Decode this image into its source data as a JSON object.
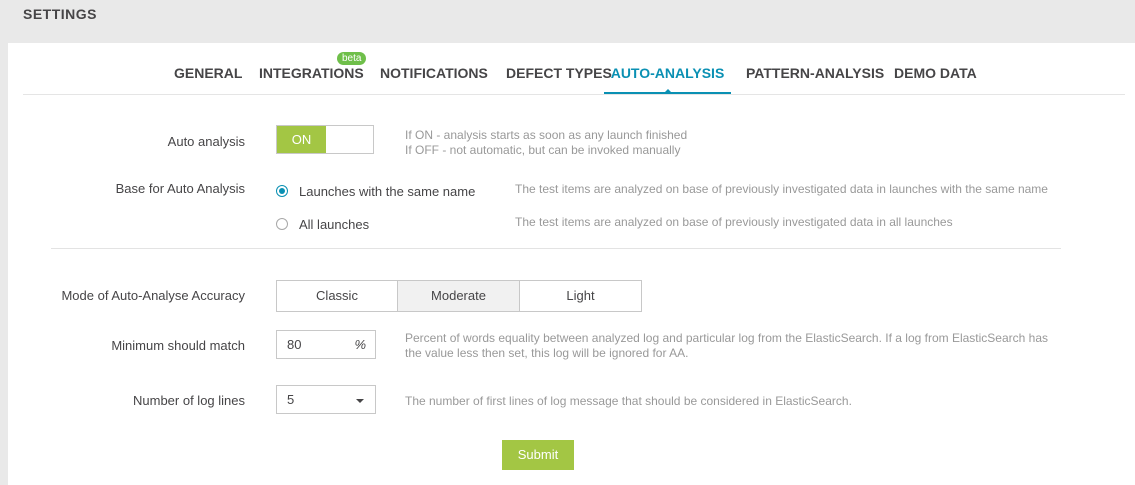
{
  "header": {
    "title": "SETTINGS"
  },
  "tabs": [
    {
      "label": "GENERAL"
    },
    {
      "label": "INTEGRATIONS",
      "badge": "beta"
    },
    {
      "label": "NOTIFICATIONS"
    },
    {
      "label": "DEFECT TYPES"
    },
    {
      "label": "AUTO-ANALYSIS",
      "active": true
    },
    {
      "label": "PATTERN-ANALYSIS"
    },
    {
      "label": "DEMO DATA"
    }
  ],
  "auto_analysis": {
    "label": "Auto analysis",
    "toggle_value": "ON",
    "hint_line1": "If ON - analysis starts as soon as any launch finished",
    "hint_line2": "If OFF - not automatic, but can be invoked manually"
  },
  "base": {
    "label": "Base for Auto Analysis",
    "options": [
      {
        "label": "Launches with the same name",
        "checked": true,
        "hint": "The test items are analyzed on base of previously investigated data in launches with the same name"
      },
      {
        "label": "All launches",
        "checked": false,
        "hint": "The test items are analyzed on base of previously investigated data in all launches"
      }
    ]
  },
  "mode": {
    "label": "Mode of Auto-Analyse Accuracy",
    "options": [
      "Classic",
      "Moderate",
      "Light"
    ],
    "selected": "Moderate"
  },
  "min_match": {
    "label": "Minimum should match",
    "value": "80",
    "suffix": "%",
    "hint_line1": "Percent of words equality between analyzed log and particular log from the ElasticSearch. If a log from ElasticSearch has",
    "hint_line2": "the value less then set, this log will be ignored for AA."
  },
  "log_lines": {
    "label": "Number of log lines",
    "value": "5",
    "hint": "The number of first lines of log message that should be considered in ElasticSearch."
  },
  "submit_label": "Submit",
  "colors": {
    "accent": "#0a90b3",
    "toggle_on": "#a3c644",
    "submit": "#a3c644",
    "beta_badge": "#6fbf4a"
  }
}
